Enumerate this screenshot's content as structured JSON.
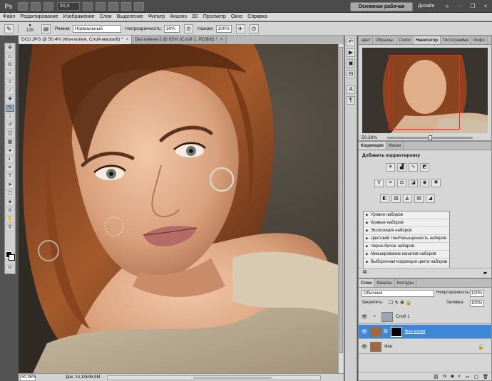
{
  "app": {
    "logo": "Ps",
    "zoom": "50,4",
    "workspace_button": "Основная рабочая среда",
    "design_label": "Дизайн",
    "more": "»",
    "minimize": "-",
    "restore": "❐",
    "close": "×"
  },
  "menu": [
    "Файл",
    "Редактирование",
    "Изображение",
    "Слои",
    "Выделение",
    "Фильтр",
    "Анализ",
    "3D",
    "Просмотр",
    "Окно",
    "Справка"
  ],
  "options": {
    "brush_size": "125",
    "mode_label": "Режим:",
    "mode_value": "Нормальный",
    "opacity_label": "Непрозрачность:",
    "opacity_value": "30%",
    "pressure_label": "Нажим:",
    "pressure_value": "100%"
  },
  "documents": {
    "tabs": [
      {
        "label": "DOJ.JPG @ 50,4% (Фон копия, Слой-маска/8) *",
        "close": "×"
      },
      {
        "label": "Без имени-3 @ 65% (Слой 1, RGB/8) *",
        "close": "×"
      }
    ]
  },
  "status": {
    "zoom": "50,36%",
    "doc": "Док: 14,1M/46,9M"
  },
  "navigator": {
    "tabs": [
      "Цвет",
      "Образцы",
      "Стили",
      "Навигатор",
      "Гистограмма",
      "Инфо"
    ],
    "zoom": "50.36%"
  },
  "adjustments": {
    "tabs": [
      "Коррекция",
      "Маски"
    ],
    "title": "Добавить корректировку",
    "presets": [
      "Уровни наборов",
      "Кривые наборов",
      "Экспозиция наборов",
      "Цветовой тон/Насыщенность наборов",
      "Черно-белое наборов",
      "Микширование каналов наборов",
      "Выборочная коррекция цвета наборов"
    ]
  },
  "layers": {
    "tabs": [
      "Слои",
      "Каналы",
      "Контуры"
    ],
    "blend_mode": "Обычные",
    "opacity_label": "Непрозрачность:",
    "opacity_value": "100%",
    "lock_label": "Закрепить:",
    "fill_label": "Заливка:",
    "fill_value": "100%",
    "items": [
      {
        "name": "Слой 1"
      },
      {
        "name": "Фон копия"
      },
      {
        "name": "Фон"
      }
    ]
  }
}
